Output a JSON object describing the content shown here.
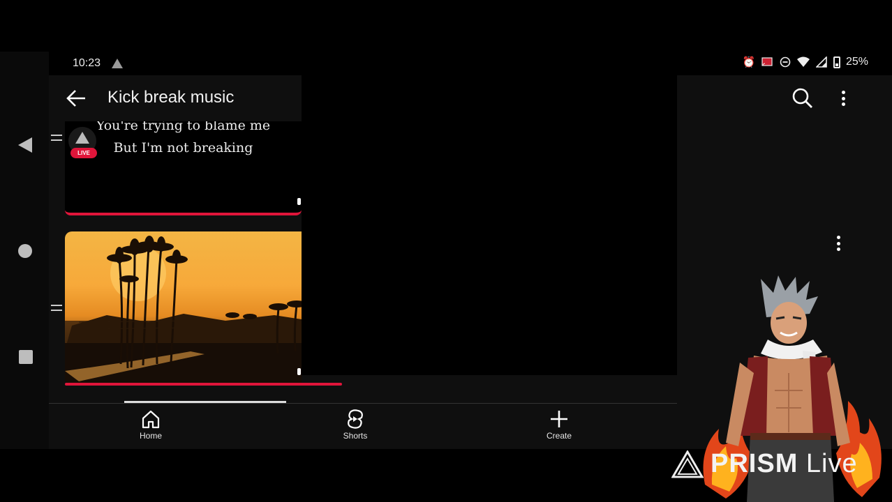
{
  "status_bar": {
    "time": "10:23",
    "battery": "25%",
    "icons": [
      "alarm-icon",
      "cast-icon",
      "dnd-icon",
      "wifi-icon",
      "signal-icon",
      "battery-icon"
    ]
  },
  "app_bar": {
    "title": "Kick break music",
    "back_icon": "back-arrow-icon",
    "search_icon": "search-icon",
    "more_icon": "more-vert-icon"
  },
  "videos": [
    {
      "lyrics": [
        "You're trying to blame me",
        "But I'm not breaking"
      ],
      "live_badge": "LIVE",
      "progress_color": "#e0153a"
    },
    {
      "thumbnail": "palm-trees-sunset",
      "progress_color": "#e0153a"
    }
  ],
  "bottom_nav": {
    "items": [
      {
        "label": "Home",
        "icon": "home-icon"
      },
      {
        "label": "Shorts",
        "icon": "shorts-icon"
      },
      {
        "label": "Create",
        "icon": "plus-icon"
      }
    ]
  },
  "watermark": {
    "brand_main": "PRISM",
    "brand_sub": "Live"
  },
  "colors": {
    "accent": "#e0153a",
    "background": "#0f0f0f"
  }
}
